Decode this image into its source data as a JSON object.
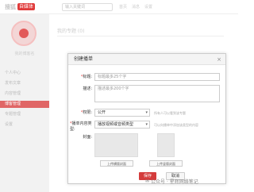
{
  "topbar": {
    "logo_text": "搜狐",
    "logo_badge": "自媒体",
    "search_placeholder": "输入关键词",
    "links": [
      "首页",
      "消息",
      "设置"
    ]
  },
  "sidebar": {
    "user_name": "我的博客名",
    "items": [
      {
        "label": "个人中心",
        "active": false
      },
      {
        "label": "发布文章",
        "active": false
      },
      {
        "label": "内容管理",
        "active": false
      },
      {
        "label": "博客管理",
        "active": true
      },
      {
        "label": "专题管理",
        "active": false
      },
      {
        "label": "设置",
        "active": false
      }
    ]
  },
  "behind": {
    "title": "我的专题 (0)"
  },
  "modal": {
    "title": "创建播单",
    "close": "×",
    "fields": {
      "title_label": "标题:",
      "title_placeholder": "标题最多25个字",
      "desc_label": "描述:",
      "desc_placeholder": "描述最多200个字",
      "perm_label": "权限:",
      "perm_value": "公开",
      "perm_hint": "所有人可以看到该专题",
      "type_label": "播单内容类型:",
      "type_value": "播放视频或音频类型",
      "type_hint": "可以向播单中添加该类型的内容",
      "cover_label": "封面:"
    },
    "cover_buttons": [
      "上传横版封面",
      "上传竖版封面"
    ],
    "save": "保存",
    "cancel": "取消"
  },
  "watermark": "公众号 · 星辉网络笔记"
}
